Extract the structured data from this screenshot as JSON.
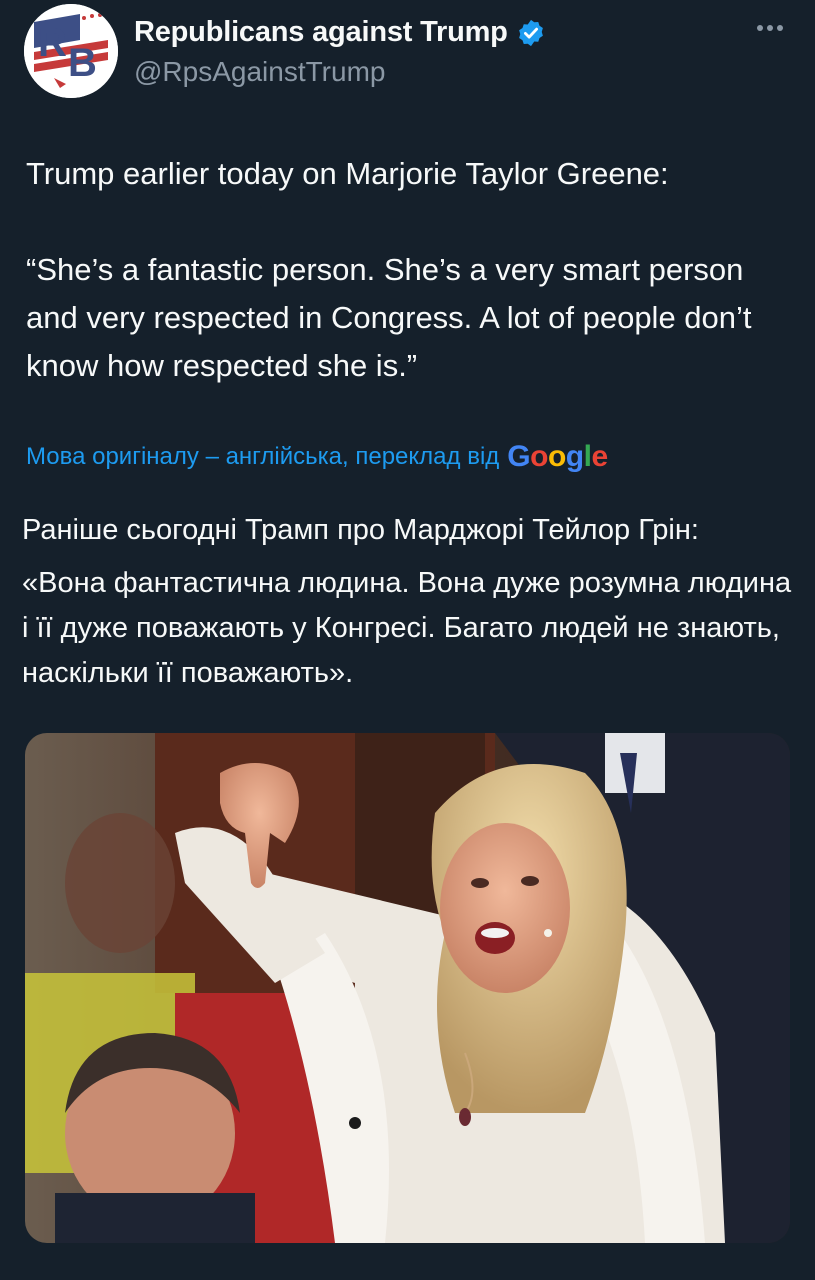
{
  "account": {
    "display_name": "Republicans against Trump",
    "handle": "@RpsAgainstTrump",
    "avatar_initials": "RB",
    "verified": true
  },
  "tweet": {
    "text": "Trump earlier today on Marjorie Taylor Greene:\n\n“She’s a fantastic person. She’s a very smart person and very respected in Congress. A lot of people don’t know how respected she is.”"
  },
  "translation": {
    "label": "Мова оригіналу – англійська, переклад від",
    "provider": "Google",
    "paragraph_1": "Раніше сьогодні Трамп про Марджорі Тейлор Грін:",
    "paragraph_2": "«Вона фантастична людина. Вона дуже розумна людина і її дуже поважають у Конгресі. Багато людей не знають, наскільки її поважають»."
  },
  "media": {
    "kind": "photo",
    "subject": "woman in white fur-trimmed coat giving thumbs-down"
  },
  "icons": {
    "verified": "verified-badge-icon",
    "more": "more-options-icon"
  },
  "colors": {
    "background": "#15202b",
    "text": "#f7f9f9",
    "secondary": "#8b98a5",
    "link": "#1d9bf0"
  }
}
